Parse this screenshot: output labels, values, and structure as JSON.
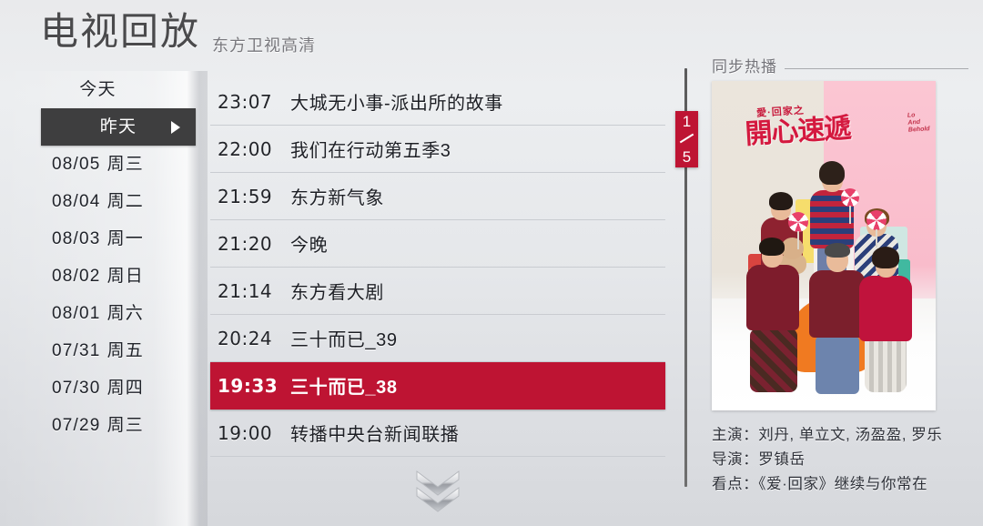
{
  "header": {
    "title": "电视回放",
    "channel": "东方卫视高清"
  },
  "sidebar": {
    "dates": [
      {
        "label": "今天",
        "day": "",
        "selected": false
      },
      {
        "label": "昨天",
        "day": "",
        "selected": true
      },
      {
        "label": "08/05",
        "day": "周三",
        "selected": false
      },
      {
        "label": "08/04",
        "day": "周二",
        "selected": false
      },
      {
        "label": "08/03",
        "day": "周一",
        "selected": false
      },
      {
        "label": "08/02",
        "day": "周日",
        "selected": false
      },
      {
        "label": "08/01",
        "day": "周六",
        "selected": false
      },
      {
        "label": "07/31",
        "day": "周五",
        "selected": false
      },
      {
        "label": "07/30",
        "day": "周四",
        "selected": false
      },
      {
        "label": "07/29",
        "day": "周三",
        "selected": false
      }
    ]
  },
  "programs": [
    {
      "time": "23:07",
      "title": "大城无小事-派出所的故事",
      "active": false
    },
    {
      "time": "22:00",
      "title": "我们在行动第五季3",
      "active": false
    },
    {
      "time": "21:59",
      "title": "东方新气象",
      "active": false
    },
    {
      "time": "21:20",
      "title": "今晚",
      "active": false
    },
    {
      "time": "21:14",
      "title": "东方看大剧",
      "active": false
    },
    {
      "time": "20:24",
      "title": "三十而已_39",
      "active": false
    },
    {
      "time": "19:33",
      "title": "三十而已_38",
      "active": true
    },
    {
      "time": "19:00",
      "title": "转播中央台新闻联播",
      "active": false
    }
  ],
  "pagination": {
    "current": "1",
    "total": "5"
  },
  "promo": {
    "section_label": "同步热播",
    "poster": {
      "logo_top": "愛·回家之",
      "logo_main": "開心速遞",
      "logo_en_line1": "Lo",
      "logo_en_line2": "And",
      "logo_en_line3": "Behold"
    },
    "description": [
      "主演：刘丹, 单立文, 汤盈盈, 罗乐",
      "导演：罗镇岳",
      "看点：《爱·回家》继续与你常在"
    ]
  },
  "colors": {
    "accent_red": "#be1433",
    "selected_dark": "#3e3e3f",
    "title_gray": "#4a4a4c",
    "channel_gray": "#79797e"
  }
}
